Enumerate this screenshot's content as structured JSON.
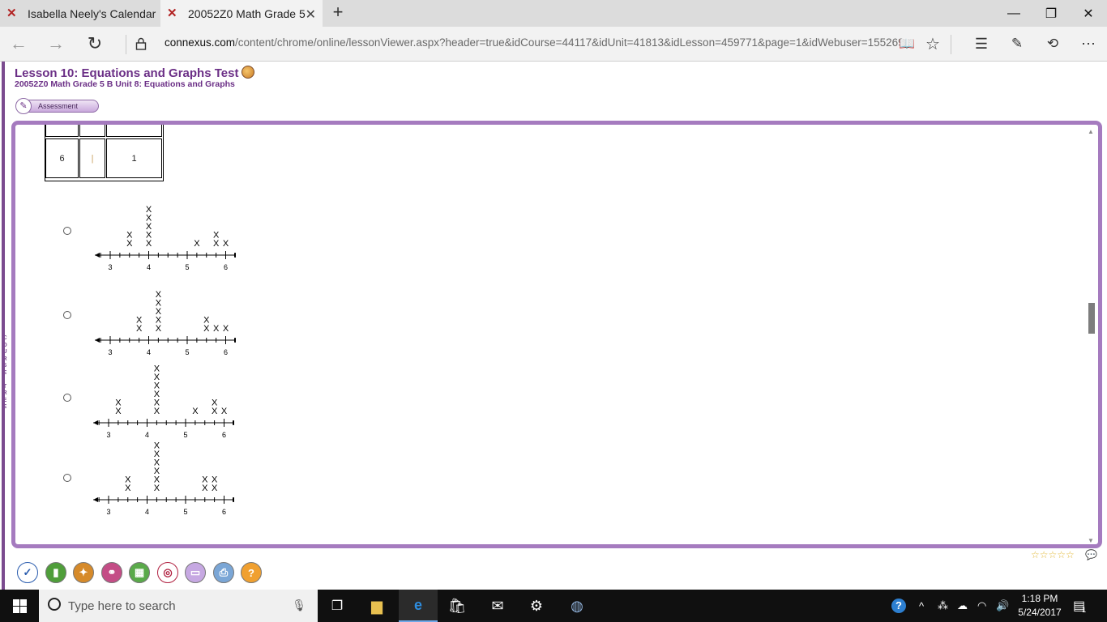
{
  "browser": {
    "tabs": [
      {
        "title": "Isabella Neely's Calendar",
        "active": false
      },
      {
        "title": "20052Z0 Math Grade 5",
        "active": true
      }
    ],
    "url_domain": "connexus.com",
    "url_path": "/content/chrome/online/lessonViewer.aspx?header=true&idCourse=44117&idUnit=41813&idLesson=459771&page=1&idWebuser=155269",
    "icons": [
      "back-icon",
      "forward-icon",
      "refresh-icon",
      "lock-icon",
      "reading-view-icon",
      "favorite-star-icon",
      "hub-icon",
      "web-note-icon",
      "share-icon",
      "more-icon"
    ]
  },
  "page": {
    "lesson_title": "Lesson 10: Equations and Graphs Test",
    "lesson_subtitle": "20052Z0 Math Grade 5 B  Unit 8: Equations and Graphs",
    "assessment_label": "Assessment",
    "side_tab_text": "COURSE TREE",
    "accent": "#a57bbf",
    "title_color": "#6b2f86"
  },
  "question": {
    "table_last_row": [
      "6",
      "|",
      "1"
    ],
    "tick_labels": [
      "3",
      "4",
      "5",
      "6"
    ],
    "options": [
      {
        "name": "option-a",
        "counts": [
          0,
          0,
          2,
          0,
          5,
          0,
          0,
          0,
          0,
          1,
          0,
          2,
          1
        ]
      },
      {
        "name": "option-b",
        "counts": [
          0,
          0,
          0,
          2,
          0,
          5,
          0,
          0,
          0,
          0,
          2,
          1,
          1
        ]
      },
      {
        "name": "option-c",
        "counts": [
          0,
          2,
          0,
          0,
          0,
          6,
          0,
          0,
          0,
          1,
          0,
          2,
          1
        ]
      },
      {
        "name": "option-d",
        "counts": [
          0,
          0,
          2,
          0,
          0,
          6,
          0,
          0,
          0,
          0,
          2,
          2,
          0
        ]
      }
    ]
  },
  "footer": {
    "rating_stars": 5,
    "toolbar_icons": [
      "check-icon",
      "book-icon",
      "medal-icon",
      "link-icon",
      "calculator-icon",
      "target-icon",
      "window-icon",
      "printer-icon",
      "help-icon"
    ]
  },
  "taskbar": {
    "search_placeholder": "Type here to search",
    "time": "1:18 PM",
    "date": "5/24/2017",
    "notification_count": "1"
  }
}
